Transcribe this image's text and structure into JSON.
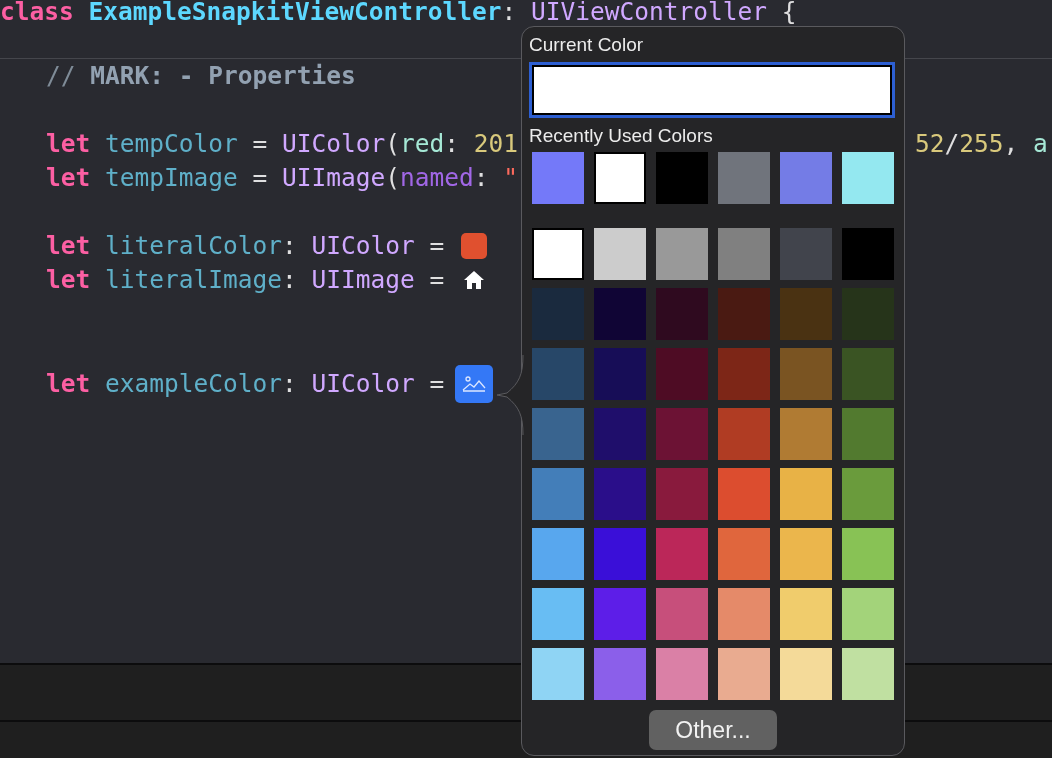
{
  "editor": {
    "header": {
      "tokens": [
        {
          "kind": "keyword",
          "text": "class"
        },
        {
          "kind": "class-name",
          "text": " ExampleSnapkitViewController"
        },
        {
          "kind": "plain",
          "text": ": "
        },
        {
          "kind": "type",
          "text": "UIViewController"
        },
        {
          "kind": "plain",
          "text": " {"
        }
      ]
    },
    "lines": [
      {
        "kind": "code",
        "tokens": [
          {
            "kind": "comment",
            "text": "// "
          },
          {
            "kind": "mark",
            "text": "MARK: - Properties"
          }
        ]
      },
      {
        "kind": "blank"
      },
      {
        "kind": "code",
        "tokens": [
          {
            "kind": "keyword",
            "text": "let"
          },
          {
            "kind": "identifier",
            "text": " tempColor"
          },
          {
            "kind": "plain",
            "text": " = "
          },
          {
            "kind": "type",
            "text": "UIColor"
          },
          {
            "kind": "plain",
            "text": "("
          },
          {
            "kind": "param",
            "text": "red"
          },
          {
            "kind": "plain",
            "text": ": "
          },
          {
            "kind": "number",
            "text": "201"
          }
        ],
        "right_tokens": [
          {
            "kind": "number",
            "text": "52"
          },
          {
            "kind": "plain",
            "text": "/"
          },
          {
            "kind": "number",
            "text": "255"
          },
          {
            "kind": "plain",
            "text": ", "
          },
          {
            "kind": "param",
            "text": "a"
          }
        ]
      },
      {
        "kind": "code",
        "tokens": [
          {
            "kind": "keyword",
            "text": "let"
          },
          {
            "kind": "identifier",
            "text": " tempImage"
          },
          {
            "kind": "plain",
            "text": " = "
          },
          {
            "kind": "type",
            "text": "UIImage"
          },
          {
            "kind": "plain",
            "text": "("
          },
          {
            "kind": "label",
            "text": "named"
          },
          {
            "kind": "plain",
            "text": ": "
          },
          {
            "kind": "string",
            "text": "\""
          }
        ]
      },
      {
        "kind": "blank"
      },
      {
        "kind": "code",
        "tokens": [
          {
            "kind": "keyword",
            "text": "let"
          },
          {
            "kind": "identifier",
            "text": " literalColor"
          },
          {
            "kind": "plain",
            "text": ": "
          },
          {
            "kind": "type",
            "text": "UIColor"
          },
          {
            "kind": "plain",
            "text": " = "
          }
        ],
        "literal": {
          "kind": "color",
          "color": "#e0502f"
        }
      },
      {
        "kind": "code",
        "tokens": [
          {
            "kind": "keyword",
            "text": "let"
          },
          {
            "kind": "identifier",
            "text": " literalImage"
          },
          {
            "kind": "plain",
            "text": ": "
          },
          {
            "kind": "type",
            "text": "UIImage"
          },
          {
            "kind": "plain",
            "text": " = "
          }
        ],
        "literal": {
          "kind": "image"
        }
      },
      {
        "kind": "blank"
      },
      {
        "kind": "blank"
      },
      {
        "kind": "code",
        "tokens": [
          {
            "kind": "keyword",
            "text": "let"
          },
          {
            "kind": "identifier",
            "text": " exampleColor"
          },
          {
            "kind": "plain",
            "text": ": "
          },
          {
            "kind": "type",
            "text": "UIColor"
          },
          {
            "kind": "plain",
            "text": " = "
          }
        ],
        "literal": {
          "kind": "image-placeholder"
        }
      }
    ]
  },
  "color_picker": {
    "current_label": "Current Color",
    "recent_label": "Recently Used Colors",
    "recent": [
      {
        "color": "#7479f9"
      },
      {
        "color": "#ffffff"
      },
      {
        "color": "#000000"
      },
      {
        "color": "#70747c"
      },
      {
        "color": "#747ce6"
      },
      {
        "color": "#94e8f0"
      }
    ],
    "palette": [
      [
        {
          "color": "#ffffff"
        },
        {
          "color": "#cccccc"
        },
        {
          "color": "#999999"
        },
        {
          "color": "#808080"
        },
        {
          "color": "#41444c"
        },
        {
          "color": "#000000"
        }
      ],
      [
        {
          "color": "#1a2a3e"
        },
        {
          "color": "#100535"
        },
        {
          "color": "#2f0a1f"
        },
        {
          "color": "#4a1a12"
        },
        {
          "color": "#4a3212"
        },
        {
          "color": "#26341a"
        }
      ],
      [
        {
          "color": "#274768"
        },
        {
          "color": "#170d57"
        },
        {
          "color": "#4e0c24"
        },
        {
          "color": "#7d2617"
        },
        {
          "color": "#7a5422"
        },
        {
          "color": "#3a5423"
        }
      ],
      [
        {
          "color": "#39648f"
        },
        {
          "color": "#1f0e6b"
        },
        {
          "color": "#6c1234"
        },
        {
          "color": "#b03c23"
        },
        {
          "color": "#b07b33"
        },
        {
          "color": "#527a2f"
        }
      ],
      [
        {
          "color": "#437eb9"
        },
        {
          "color": "#2a0e8a"
        },
        {
          "color": "#891a3d"
        },
        {
          "color": "#dc4d2f"
        },
        {
          "color": "#e8b246"
        },
        {
          "color": "#6a9b3c"
        }
      ],
      [
        {
          "color": "#58a7ee"
        },
        {
          "color": "#3a0fd8"
        },
        {
          "color": "#bb2759"
        },
        {
          "color": "#e0663d"
        },
        {
          "color": "#ebb64c"
        },
        {
          "color": "#88c255"
        }
      ],
      [
        {
          "color": "#68bdf3"
        },
        {
          "color": "#5d1ee8"
        },
        {
          "color": "#c74f7b"
        },
        {
          "color": "#e58a69"
        },
        {
          "color": "#f0cc6c"
        },
        {
          "color": "#a3d37a"
        }
      ],
      [
        {
          "color": "#8fd4f4"
        },
        {
          "color": "#8b5fea"
        },
        {
          "color": "#da80a6"
        },
        {
          "color": "#e9ab90"
        },
        {
          "color": "#f4da99"
        },
        {
          "color": "#c0e0a1"
        }
      ]
    ],
    "other_button": "Other..."
  }
}
